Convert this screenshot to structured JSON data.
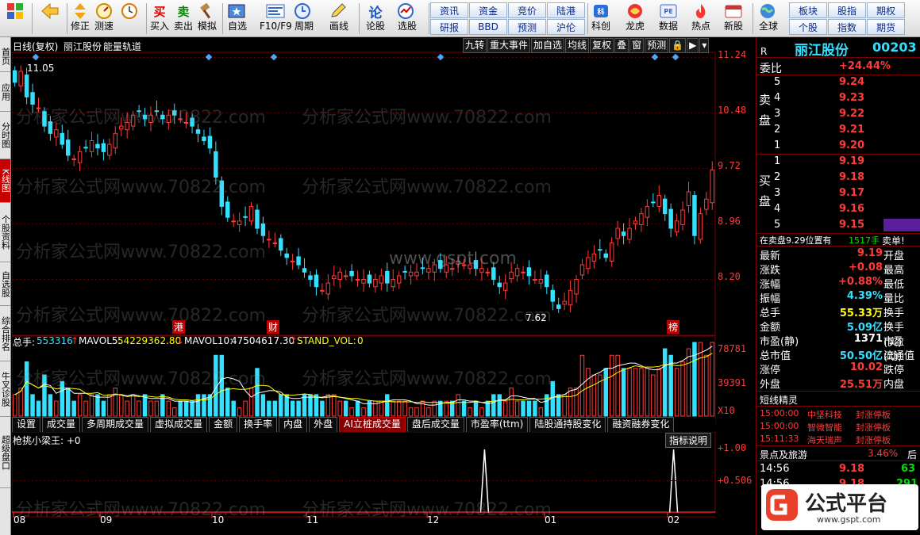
{
  "toolbar": {
    "buttons": [
      {
        "label": "",
        "icon": "windows-grid-icon"
      },
      {
        "label": "",
        "icon": "back-arrow-icon"
      },
      {
        "label": "修正",
        "icon": "up-down-arrow-icon"
      },
      {
        "label": "测速",
        "icon": "speed-dial-icon"
      },
      {
        "label": "",
        "icon": "clock-icon"
      },
      {
        "label": "买入",
        "icon": "buy-icon",
        "glyph": "买"
      },
      {
        "label": "卖出",
        "icon": "sell-icon",
        "glyph": "卖"
      },
      {
        "label": "模拟",
        "icon": "gavel-icon"
      },
      {
        "label": "自选",
        "icon": "favorites-icon"
      },
      {
        "label": "F10/F9",
        "icon": "f10-icon"
      },
      {
        "label": "周期",
        "icon": "period-icon"
      },
      {
        "label": "画线",
        "icon": "pencil-icon"
      },
      {
        "label": "论股",
        "icon": "discussion-icon"
      },
      {
        "label": "选股",
        "icon": "stock-picker-icon"
      },
      {
        "label": "科创",
        "icon": "tech-board-icon"
      },
      {
        "label": "龙虎",
        "icon": "dragon-tiger-icon"
      },
      {
        "label": "数据",
        "icon": "data-icon"
      },
      {
        "label": "热点",
        "icon": "hot-spot-icon"
      },
      {
        "label": "新股",
        "icon": "new-stock-icon"
      },
      {
        "label": "全球",
        "icon": "globe-icon"
      }
    ],
    "text_buttons_top": [
      "资讯",
      "资金",
      "竞价",
      "陆港",
      "板块",
      "股指",
      "期权"
    ],
    "text_buttons_bottom": [
      "研报",
      "BBD",
      "预测",
      "沪伦",
      "个股",
      "指数",
      "期货"
    ]
  },
  "sidebar": {
    "tabs": [
      "首页",
      "应用",
      "分时图",
      "K线图",
      "个股资料",
      "自选股",
      "综合排名",
      "牛叉诊股",
      "超级盘口"
    ]
  },
  "chart": {
    "title": "日线(复权)",
    "stock_name": "丽江股份",
    "indicator_name": "能量轨道",
    "controls": [
      "九转",
      "重大事件",
      "加自选",
      "均线",
      "复权",
      "叠",
      "窗",
      "预测",
      "",
      "",
      ""
    ],
    "price_axis": [
      "11.24",
      "10.48",
      "9.72",
      "8.96",
      "8.20"
    ],
    "high_label": "11.05",
    "low_label": "7.62",
    "event_markers": [
      "港",
      "财",
      "榜"
    ],
    "volume_header": {
      "label1": "总手:",
      "value1": "553316",
      "label2": "MAVOL5:",
      "value2": "54229362.80",
      "label3": "MAVOL10:",
      "value3": "47504617.30",
      "label4": "STAND_VOL:",
      "value4": "0"
    },
    "volume_axis": [
      "78781",
      "39391",
      "X10"
    ],
    "indicator_tabs": [
      "设置",
      "成交量",
      "多周期成交量",
      "虚拟成交量",
      "金额",
      "换手率",
      "内盘",
      "外盘",
      "AI立桩成交量",
      "盘后成交量",
      "市盈率(ttm)",
      "陆股通持股变化",
      "融资融券变化"
    ],
    "indicator_tab_active": "AI立桩成交量",
    "indicator_help": "指标说明",
    "sub_indicator_label": "枪挑小梁王: +0",
    "sub_axis": [
      "+1.00",
      "+0.506"
    ],
    "x_axis": [
      "08",
      "09",
      "10",
      "11",
      "12",
      "01",
      "02"
    ],
    "watermark": "www.gspt.com",
    "watermark2": "分析家公式网www.70822.com"
  },
  "chart_data": {
    "type": "candlestick",
    "title": "",
    "ylim": [
      7.5,
      11.3
    ],
    "volume_ylim": [
      0,
      78781
    ],
    "sub_ylim": [
      0,
      1
    ],
    "series": [
      {
        "name": "price",
        "values": [
          10.9,
          11.05,
          10.7,
          10.6,
          10.55,
          10.3,
          10.2,
          10.25,
          10.05,
          9.9,
          9.85,
          9.95,
          10.0,
          10.1,
          10.0,
          9.95,
          10.05,
          10.2,
          10.3,
          10.35,
          10.45,
          10.5,
          10.4,
          10.45,
          10.5,
          10.4,
          10.45,
          10.45,
          10.4,
          10.35,
          10.3,
          10.2,
          10.1,
          10.0,
          9.6,
          9.2,
          9.05,
          9.0,
          9.0,
          9.05,
          9.2,
          8.9,
          8.8,
          8.75,
          8.7,
          8.6,
          8.5,
          8.45,
          8.4,
          8.3,
          8.2,
          8.1,
          8.05,
          8.15,
          8.25,
          8.3,
          8.25,
          8.25,
          8.2,
          8.2,
          8.15,
          8.2,
          8.25,
          8.15,
          8.2,
          8.25,
          8.3,
          8.3,
          8.3,
          8.35,
          8.35,
          8.4,
          8.35,
          8.4,
          8.35,
          8.45,
          8.4,
          8.4,
          8.35,
          8.35,
          8.3,
          8.2,
          8.1,
          8.15,
          8.3,
          8.35,
          8.3,
          8.25,
          8.2,
          8.2,
          8.1,
          7.9,
          7.8,
          7.9,
          8.05,
          8.2,
          8.4,
          8.5,
          8.55,
          8.6,
          8.5,
          8.7,
          8.9,
          8.8,
          8.9,
          9.0,
          9.1,
          9.2,
          9.25,
          9.35,
          9.1,
          8.9,
          9.0,
          9.15,
          9.4,
          8.8,
          9.1,
          9.3,
          9.7
        ]
      },
      {
        "name": "event_flag",
        "values": [
          [
            125,
            1
          ],
          [
            175,
            1
          ]
        ]
      }
    ]
  },
  "right_panel": {
    "title": "丽江股份",
    "code": "00203",
    "weibi_label": "委比",
    "weibi_value": "+24.44%",
    "sell_label": "卖盘",
    "buy_label": "买盘",
    "sell": [
      {
        "level": "5",
        "price": "9.24"
      },
      {
        "level": "4",
        "price": "9.23"
      },
      {
        "level": "3",
        "price": "9.22"
      },
      {
        "level": "2",
        "price": "9.21"
      },
      {
        "level": "1",
        "price": "9.20"
      }
    ],
    "buy": [
      {
        "level": "1",
        "price": "9.19"
      },
      {
        "level": "2",
        "price": "9.18"
      },
      {
        "level": "3",
        "price": "9.17"
      },
      {
        "level": "4",
        "price": "9.16"
      },
      {
        "level": "5",
        "price": "9.15"
      }
    ],
    "r_label": "R",
    "order_note": "在卖盘9.29位置有",
    "order_qty": "1517手",
    "order_tag": "卖单!",
    "quote_rows": [
      {
        "a": "最新",
        "v": "9.19",
        "b": "开盘",
        "c": "red"
      },
      {
        "a": "涨跌",
        "v": "+0.08",
        "b": "最高",
        "c": "red"
      },
      {
        "a": "涨幅",
        "v": "+0.88%",
        "b": "最低",
        "c": "red"
      },
      {
        "a": "振幅",
        "v": "4.39%",
        "b": "量比",
        "c": "cyn"
      },
      {
        "a": "总手",
        "v": "55.33万",
        "b": "换手",
        "c": "yel"
      },
      {
        "a": "金额",
        "v": "5.09亿",
        "b": "换手(实)",
        "c": "cyn"
      },
      {
        "a": "市盈(静)",
        "v": "1371",
        "b": "市盈(动)",
        "c": "wht"
      },
      {
        "a": "总市值",
        "v": "50.50亿",
        "b": "流通值",
        "c": "cyn"
      },
      {
        "a": "涨停",
        "v": "10.02",
        "b": "跌停",
        "c": "red"
      },
      {
        "a": "外盘",
        "v": "25.51万",
        "b": "内盘",
        "c": "red"
      }
    ],
    "news_title": "短线精灵",
    "news": [
      {
        "time": "15:00:00",
        "name": "中坚科技",
        "event": "封涨停板"
      },
      {
        "time": "15:00:00",
        "name": "智微智能",
        "event": "封涨停板"
      },
      {
        "time": "15:11:33",
        "name": "海天瑞声",
        "event": "封涨停板"
      }
    ],
    "sector_name": "景点及旅游",
    "sector_pct": "3.46%",
    "sector_extra": "后",
    "ticks": [
      {
        "time": "14:56",
        "price": "9.18",
        "vol": "63"
      },
      {
        "time": "14:56",
        "price": "9.18",
        "vol": "291"
      }
    ],
    "logo_text": "公式平台",
    "logo_url": "www.gspt.com"
  }
}
